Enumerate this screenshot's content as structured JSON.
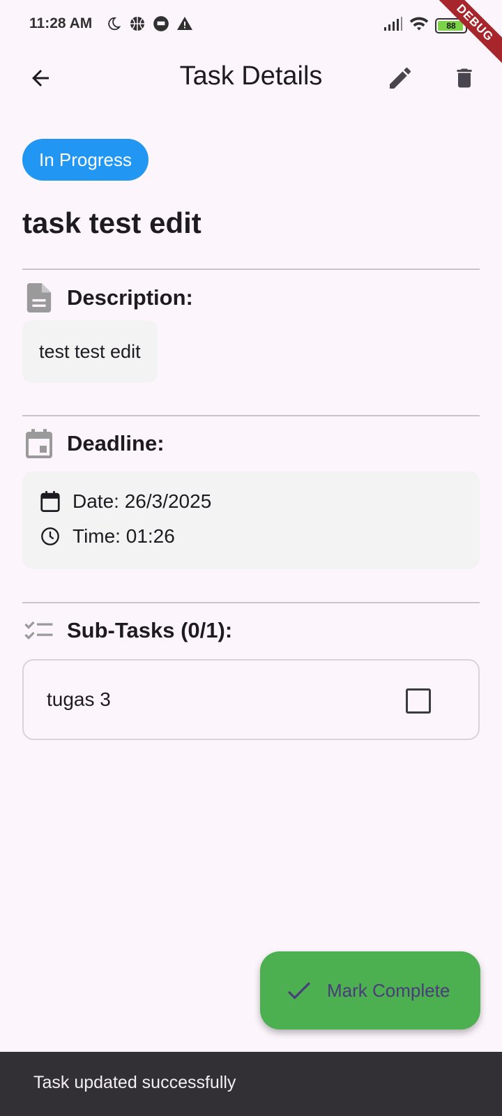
{
  "status_bar": {
    "time": "11:28 AM",
    "battery_level": "88",
    "icons_left": [
      "moon-icon",
      "basketball-icon",
      "message-icon",
      "warning-icon"
    ],
    "icons_right": [
      "signal-icon",
      "wifi-icon",
      "battery-icon",
      "charging-icon"
    ]
  },
  "debug_banner": "DEBUG",
  "app_bar": {
    "title": "Task Details",
    "back_icon": "arrow-back-icon",
    "edit_icon": "pencil-icon",
    "delete_icon": "trash-icon"
  },
  "task": {
    "status": "In Progress",
    "status_color": "#2196F3",
    "title": "task test edit"
  },
  "description": {
    "label": "Description:",
    "text": "test test edit"
  },
  "deadline": {
    "label": "Deadline:",
    "date": "Date: 26/3/2025",
    "time": "Time: 01:26"
  },
  "subtasks": {
    "label": "Sub-Tasks (0/1):",
    "items": [
      {
        "label": "tugas 3",
        "checked": false
      }
    ]
  },
  "fab": {
    "label": "Mark Complete",
    "color": "#4CAF50"
  },
  "snackbar": {
    "message": "Task updated successfully"
  }
}
